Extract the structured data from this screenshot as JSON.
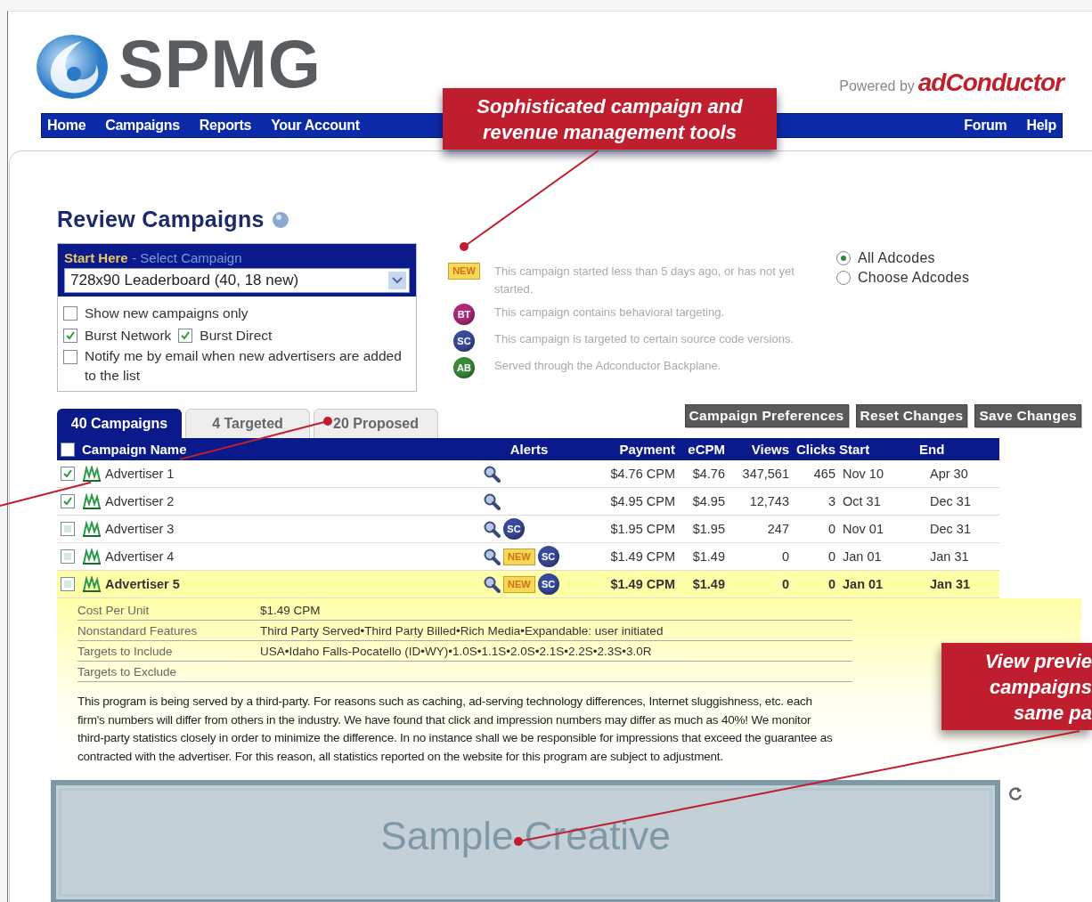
{
  "logo": {
    "text": "SPMG"
  },
  "powered_by": {
    "label": "Powered by",
    "brand": "adConductor"
  },
  "nav": {
    "left": [
      "Home",
      "Campaigns",
      "Reports",
      "Your Account"
    ],
    "right": [
      "Forum",
      "Help"
    ]
  },
  "title": "Review Campaigns",
  "selector": {
    "heading": "Start Here",
    "subheading": "- Select Campaign",
    "value": "728x90 Leaderboard (40, 18 new)"
  },
  "filters": [
    {
      "label": "Show new campaigns only",
      "checked": false
    },
    {
      "label": "Burst Network",
      "checked": true
    },
    {
      "label": "Burst Direct",
      "checked": true
    },
    {
      "label": "Notify me by email when new advertisers are added to the list",
      "checked": false
    }
  ],
  "legend": [
    {
      "kind": "new",
      "badge": "NEW",
      "text": "This campaign started less than 5 days ago, or has not yet started."
    },
    {
      "kind": "bt",
      "badge": "BT",
      "text": "This campaign contains behavioral targeting."
    },
    {
      "kind": "sc",
      "badge": "SC",
      "text": "This campaign is targeted to certain source code versions."
    },
    {
      "kind": "ab",
      "badge": "AB",
      "text": "Served through the Adconductor Backplane."
    }
  ],
  "radios": [
    {
      "label": "All Adcodes",
      "selected": true
    },
    {
      "label": "Choose Adcodes",
      "selected": false
    }
  ],
  "tabs": [
    {
      "label": "40 Campaigns",
      "selected": true
    },
    {
      "label": "4 Targeted",
      "selected": false
    },
    {
      "label": "20 Proposed",
      "selected": false
    }
  ],
  "buttons": [
    "Campaign Preferences",
    "Reset Changes",
    "Save Changes"
  ],
  "table": {
    "select_all_checked": false,
    "columns": [
      "Campaign Name",
      "Alerts",
      "Payment",
      "eCPM",
      "Views",
      "Clicks",
      "Start",
      "End"
    ],
    "rows": [
      {
        "checked": true,
        "selected": false,
        "name": "Advertiser 1",
        "alerts": [
          {
            "kind": "search"
          }
        ],
        "payment": "$4.76 CPM",
        "ecpm": "$4.76",
        "views": "347,561",
        "clicks": "465",
        "start": "Nov 10",
        "end": "Apr 30"
      },
      {
        "checked": true,
        "selected": false,
        "name": "Advertiser 2",
        "alerts": [
          {
            "kind": "search"
          }
        ],
        "payment": "$4.95 CPM",
        "ecpm": "$4.95",
        "views": "12,743",
        "clicks": "3",
        "start": "Oct 31",
        "end": "Dec 31"
      },
      {
        "checked": false,
        "selected": false,
        "name": "Advertiser 3",
        "alerts": [
          {
            "kind": "search"
          },
          {
            "kind": "sc",
            "label": "SC"
          }
        ],
        "payment": "$1.95 CPM",
        "ecpm": "$1.95",
        "views": "247",
        "clicks": "0",
        "start": "Nov 01",
        "end": "Dec 31"
      },
      {
        "checked": false,
        "selected": false,
        "name": "Advertiser 4",
        "alerts": [
          {
            "kind": "search"
          },
          {
            "kind": "new",
            "label": "NEW"
          },
          {
            "kind": "sc",
            "label": "SC"
          }
        ],
        "payment": "$1.49 CPM",
        "ecpm": "$1.49",
        "views": "0",
        "clicks": "0",
        "start": "Jan 01",
        "end": "Jan 31"
      },
      {
        "checked": false,
        "selected": true,
        "name": "Advertiser 5",
        "alerts": [
          {
            "kind": "search"
          },
          {
            "kind": "new",
            "label": "NEW"
          },
          {
            "kind": "sc",
            "label": "SC"
          }
        ],
        "payment": "$1.49 CPM",
        "ecpm": "$1.49",
        "views": "0",
        "clicks": "0",
        "start": "Jan 01",
        "end": "Jan 31"
      }
    ]
  },
  "details": [
    {
      "label": "Cost Per Unit",
      "value": "$1.49 CPM"
    },
    {
      "label": "Nonstandard Features",
      "value": "Third Party Served•Third Party Billed•Rich Media•Expandable: user initiated"
    },
    {
      "label": "Targets to Include",
      "value": "USA•Idaho Falls-Pocatello (ID•WY)•1.0S•1.1S•2.0S•2.1S•2.2S•2.3S•3.0R"
    },
    {
      "label": "Targets to Exclude"
    }
  ],
  "disclaimer": "This program is being served by a third-party. For reasons such as caching, ad-serving technology differences, Internet sluggishness, etc. each firm's numbers will differ from others in the industry. We have found that click and impression numbers may differ as much as 40%! We monitor third-party statistics closely in order to minimize the difference. In no instance shall we be responsible for impressions that exceed the guarantee as contracted with the advertiser. For this reason, all statistics reported on the website for this program are subject to adjustment.",
  "creative": {
    "label": "Sample Creative"
  },
  "callouts": [
    {
      "lines": [
        "Sophisticated campaign and",
        "revenue management tools"
      ]
    },
    {
      "lines": [
        "View previe",
        "campaigns",
        "same pa"
      ]
    }
  ]
}
